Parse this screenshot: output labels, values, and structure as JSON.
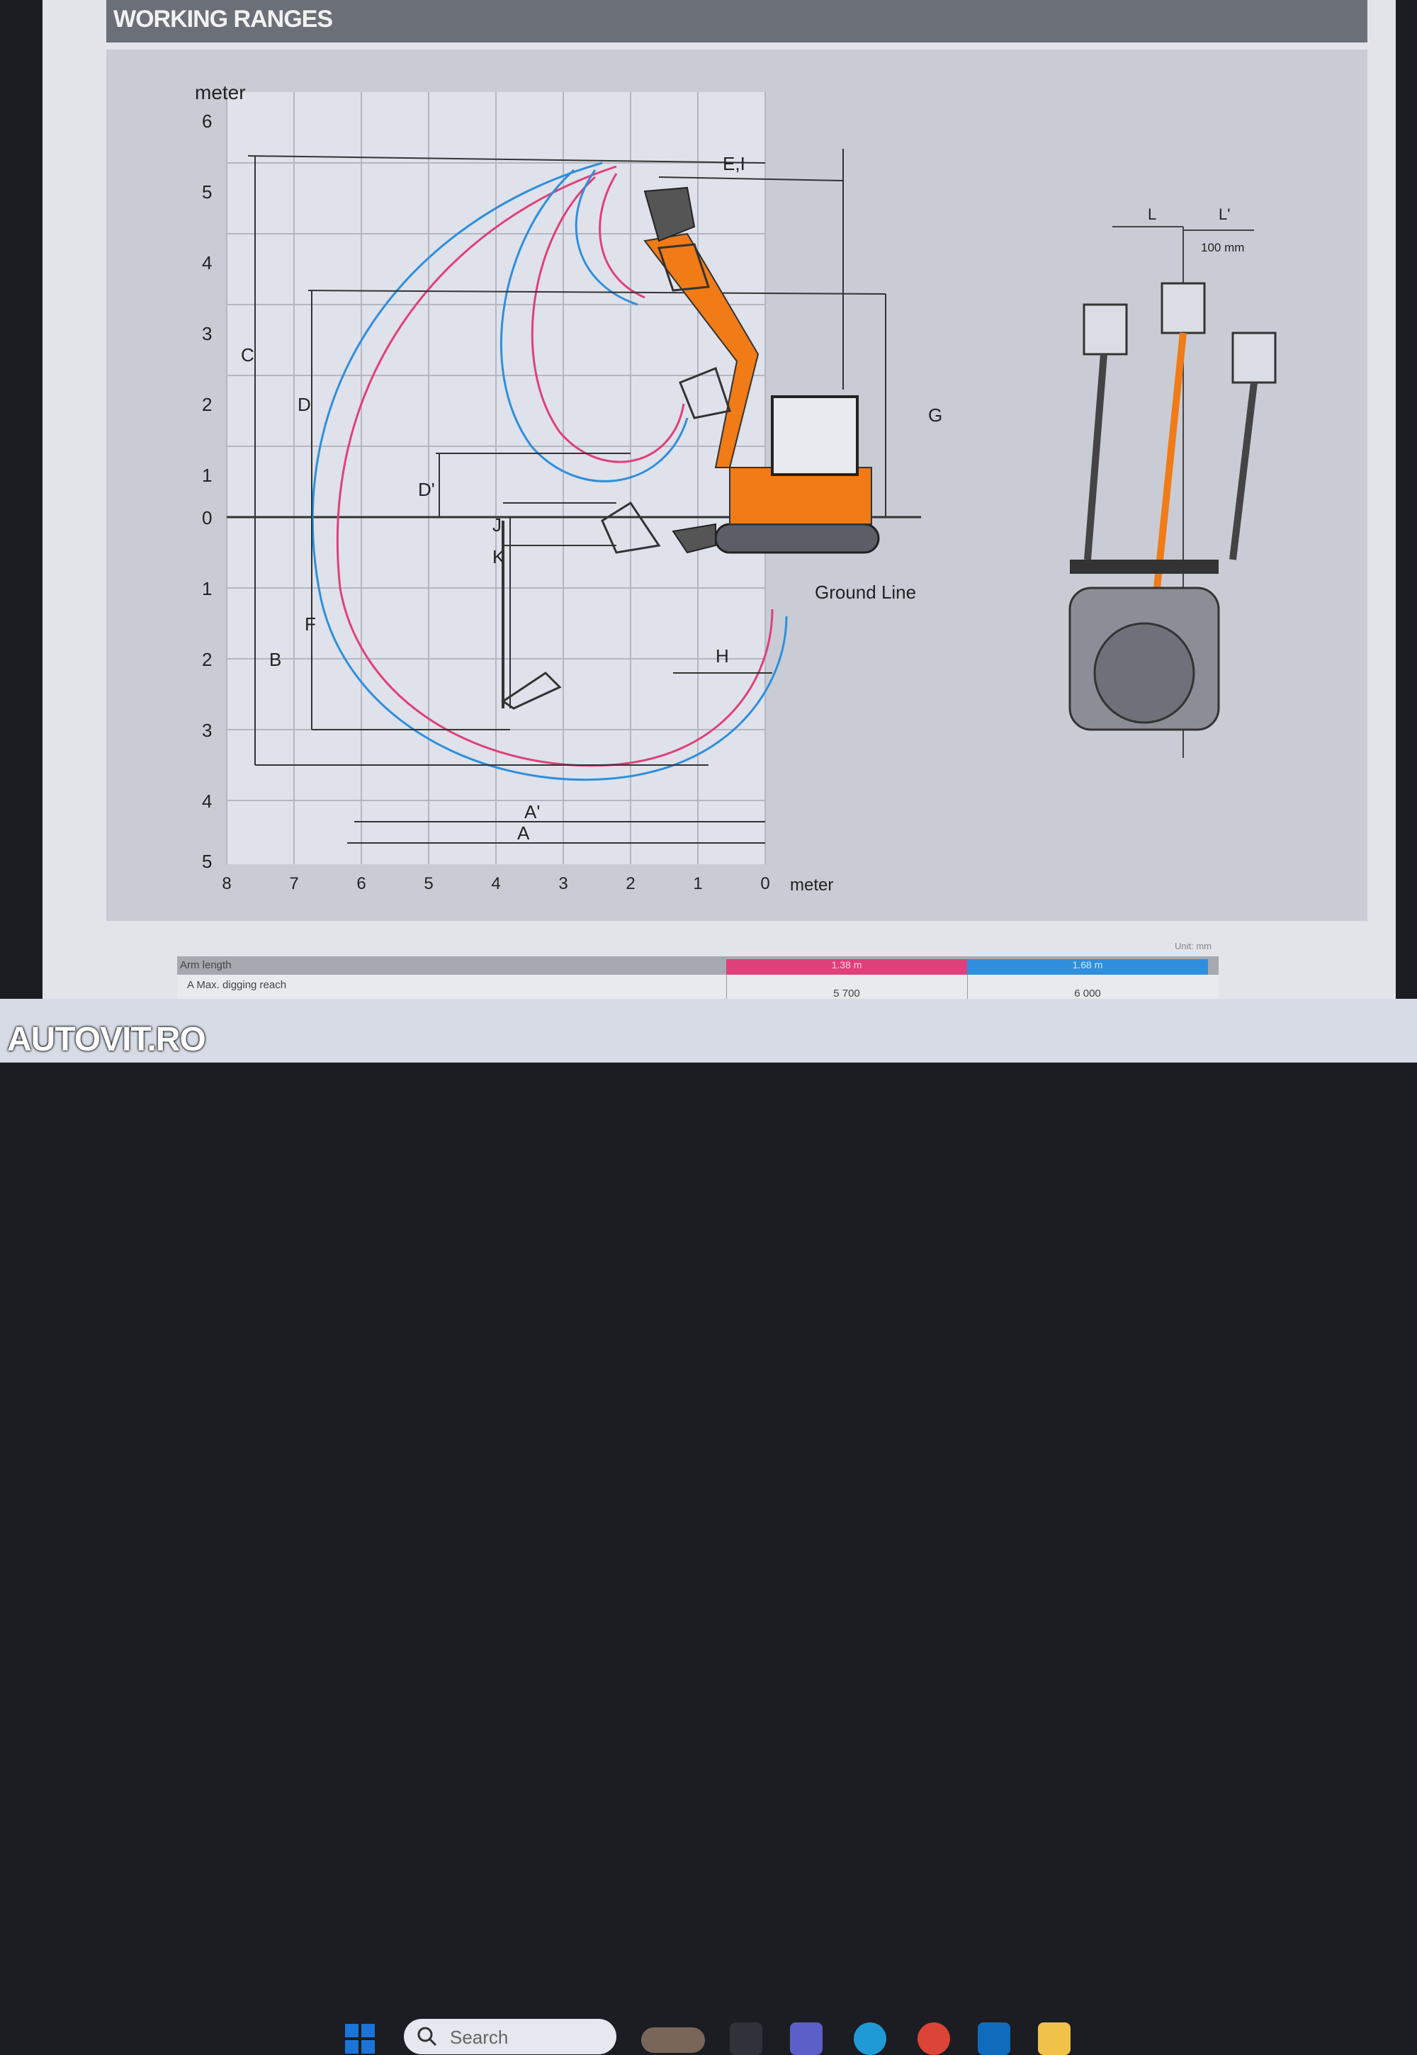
{
  "header": {
    "title": "WORKING RANGES"
  },
  "diagram": {
    "y_unit": "meter",
    "x_unit": "meter",
    "y_ticks_up": [
      "6",
      "5",
      "4",
      "3",
      "2",
      "1",
      "0"
    ],
    "y_ticks_down": [
      "1",
      "2",
      "3",
      "4",
      "5"
    ],
    "x_ticks": [
      "8",
      "7",
      "6",
      "5",
      "4",
      "3",
      "2",
      "1",
      "0"
    ],
    "dimension_labels": {
      "c": "C",
      "d": "D",
      "d_prime": "D'",
      "e_i": "E,I",
      "g": "G",
      "j": "J",
      "k": "K",
      "f": "F",
      "b": "B",
      "h": "H",
      "a_prime": "A'",
      "a": "A",
      "l": "L",
      "l_prime": "L'"
    },
    "ground_line_label": "Ground Line",
    "offset_label": "100 mm",
    "colors": {
      "pink_arm": "#e0407a",
      "blue_arm": "#2f8fdc",
      "machine_orange": "#f07b17"
    }
  },
  "specs": {
    "unit": "Unit: mm",
    "header_label": "Arm length",
    "pink_header": "1.38 m",
    "blue_header": "1.68 m",
    "row_label": "A   Max. digging reach",
    "pink_value": "5 700",
    "blue_value": "6 000"
  },
  "taskbar": {
    "brand": "AUTOVIT.RO",
    "search_placeholder": "Search",
    "icons": [
      "windows-start-icon",
      "search-icon",
      "weather-icon",
      "file-explorer-icon",
      "teams-icon",
      "edge-icon",
      "chrome-icon",
      "outlook-icon",
      "folder-icon"
    ]
  }
}
